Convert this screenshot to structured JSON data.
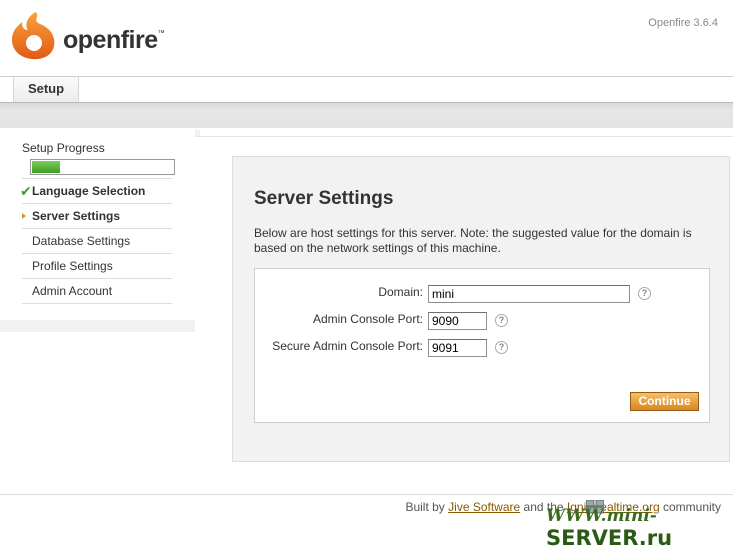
{
  "header": {
    "logo_text": "openfire",
    "logo_tm": "™",
    "version": "Openfire 3.6.4"
  },
  "tabs": [
    {
      "label": "Setup"
    }
  ],
  "sidebar": {
    "title": "Setup Progress",
    "progress": 0.2,
    "items": [
      {
        "label": "Language Selection",
        "state": "done"
      },
      {
        "label": "Server Settings",
        "state": "current"
      },
      {
        "label": "Database Settings",
        "state": "pending"
      },
      {
        "label": "Profile Settings",
        "state": "pending"
      },
      {
        "label": "Admin Account",
        "state": "pending"
      }
    ]
  },
  "main": {
    "title": "Server Settings",
    "description": "Below are host settings for this server. Note: the suggested value for the domain is based on the network settings of this machine.",
    "fields": {
      "domain": {
        "label": "Domain:",
        "value": "mini"
      },
      "admin_port": {
        "label": "Admin Console Port:",
        "value": "9090"
      },
      "secure_port": {
        "label": "Secure Admin Console Port:",
        "value": "9091"
      }
    },
    "help_glyph": "?",
    "continue_label": "Continue"
  },
  "footer": {
    "built_by": "Built by",
    "jive_link": "Jive Software",
    "and_the": "and the",
    "ignite_link": "Igniterealtime.org",
    "community": "community"
  },
  "watermark": {
    "prefix": "WWW.mini-",
    "suffix": "SERVER.ru"
  },
  "colors": {
    "accent_orange": "#d8871f",
    "progress_green": "#3d9e23",
    "link": "#8a5a00"
  }
}
